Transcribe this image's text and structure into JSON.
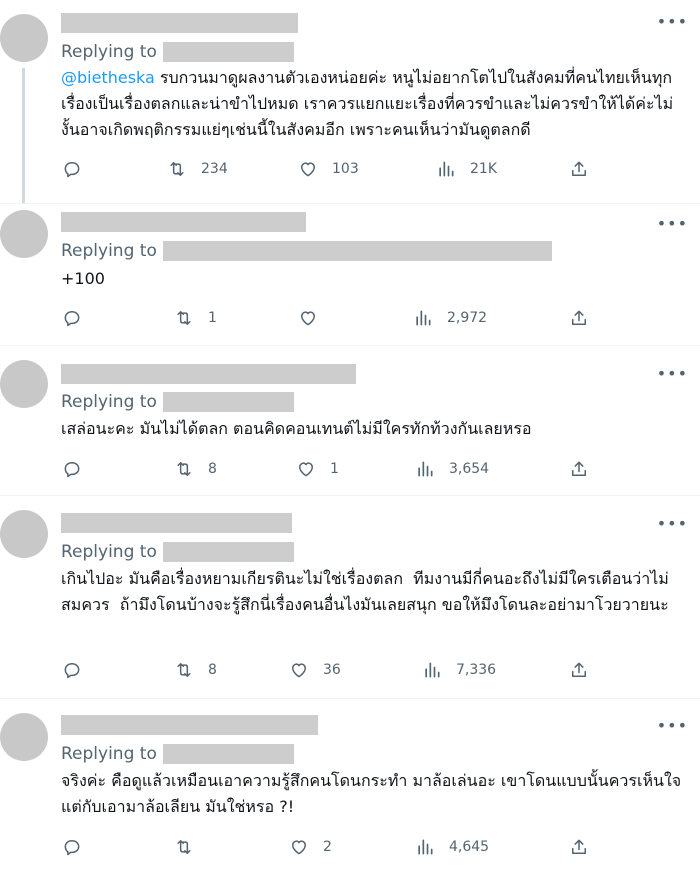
{
  "reply_prefix": "Replying to",
  "icons": {
    "more": "more-icon",
    "reply": "reply-icon",
    "retweet": "retweet-icon",
    "like": "like-icon",
    "views": "views-icon",
    "share": "share-icon"
  },
  "colors": {
    "mention": "#1d9bf0",
    "muted": "#536471",
    "redaction": "#cdcdcd"
  },
  "tweets": [
    {
      "mention": "@bietheska",
      "text": " รบกวนมาดูผลงานตัวเองหน่อยค่ะ หนูไม่อยากโตไปในสังคมที่คนไทยเห็นทุกเรื่องเป็นเรื่องตลกและน่าขำไปหมด เราควรแยกแยะเรื่องที่ควรขำและไม่ควรขำให้ได้ค่ะไม่งั้นอาจเกิดพฤติกรรมแย่ๆเช่นนี้ในสังคมอีก เพราะคนเห็นว่ามันดูตลกดี",
      "retweets": "234",
      "likes": "103",
      "views": "21K"
    },
    {
      "mention": "",
      "text": "+100",
      "retweets": "1",
      "likes": "",
      "views": "2,972"
    },
    {
      "mention": "",
      "text": "เสล่อนะคะ มันไม่ได้ตลก ตอนคิดคอนเทนต์ไม่มีใครทักท้วงกันเลยหรอ",
      "retweets": "8",
      "likes": "1",
      "views": "3,654"
    },
    {
      "mention": "",
      "text": "เกินไปอะ มันคือเรื่องหยามเกียรตินะไม่ใช่เรื่องตลก  ทีมงานมีกี่คนอะถึงไม่มีใครเตือนว่าไม่สมควร  ถ้ามึงโดนบ้างจะรู้สึกนี่เรื่องคนอื่นไงมันเลยสนุก ขอให้มึงโดนละอย่ามาโวยวายนะ",
      "retweets": "8",
      "likes": "36",
      "views": "7,336"
    },
    {
      "mention": "",
      "text": "จริงค่ะ คือดูแล้วเหมือนเอาความรู้สึกคนโดนกระทำ มาล้อเล่นอะ เขาโดนแบบนั้นควรเห็นใจ แต่กับเอามาล้อเลียน มันใช่หรอ ?!",
      "retweets": "",
      "likes": "2",
      "views": "4,645"
    }
  ]
}
